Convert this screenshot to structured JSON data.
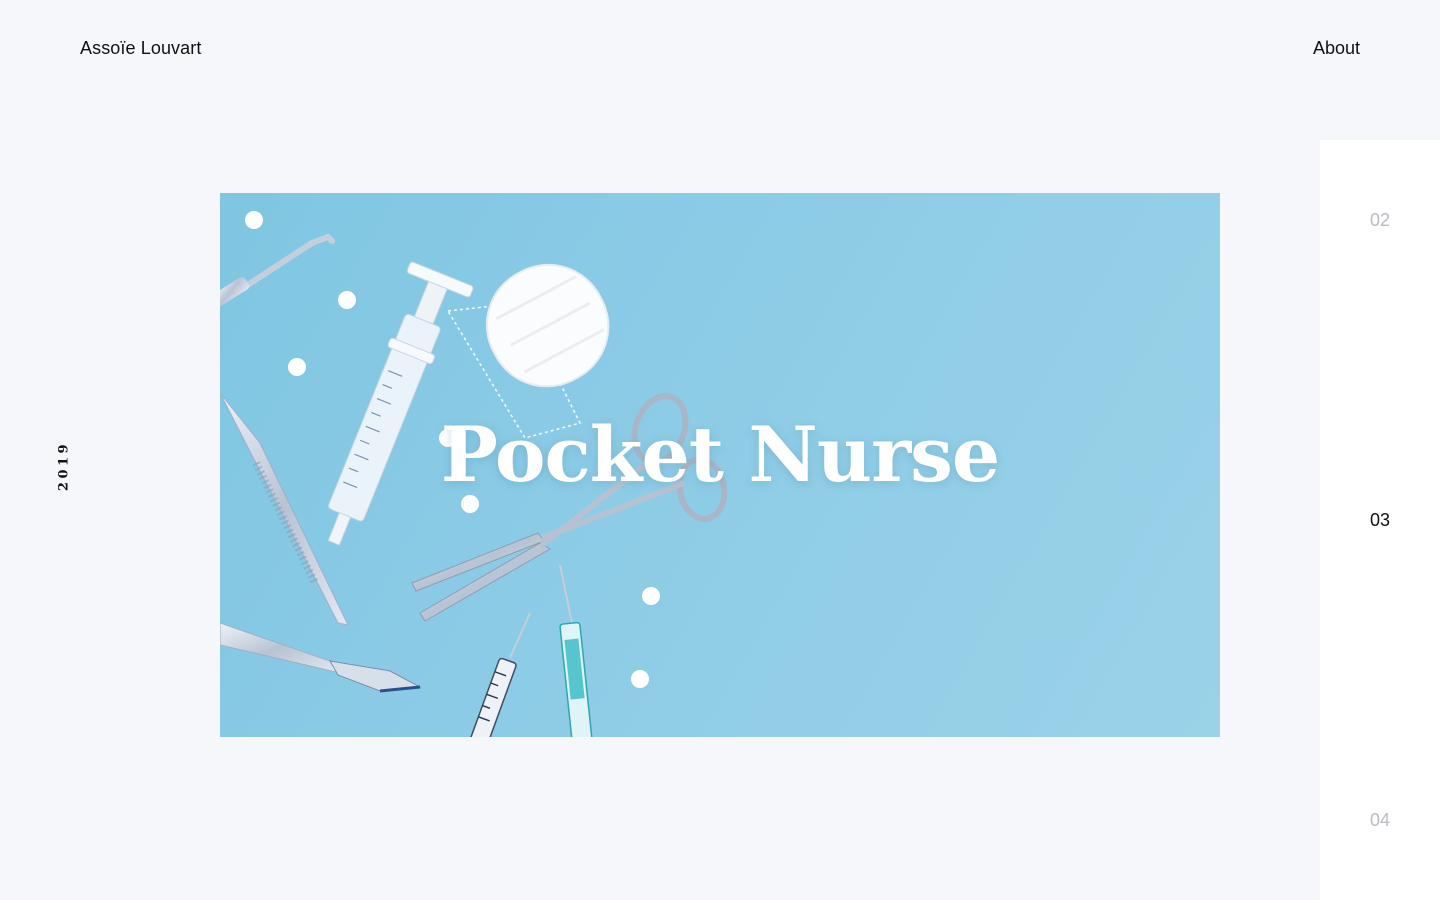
{
  "header": {
    "brand": "Assoïe Louvart",
    "about_label": "About"
  },
  "project": {
    "year": "2019",
    "title": "Pocket Nurse"
  },
  "pager": {
    "items": [
      "02",
      "03",
      "04"
    ],
    "active": "03"
  },
  "colors": {
    "background": "#f5f7fa",
    "hero_blue": "#8ccbe6",
    "text": "#111111",
    "muted": "#b9bcc2"
  }
}
